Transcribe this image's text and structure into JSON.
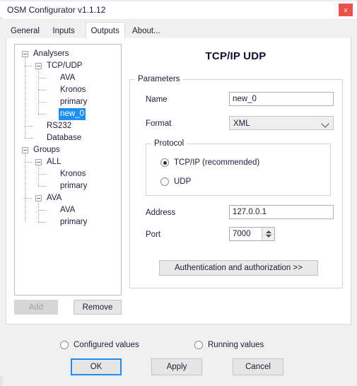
{
  "window": {
    "title": "OSM Configurator v1.1.12",
    "close_label": "x"
  },
  "tabs": [
    {
      "label": "General",
      "active": false
    },
    {
      "label": "Inputs",
      "active": false
    },
    {
      "label": "Outputs",
      "active": true
    },
    {
      "label": "About...",
      "active": false
    }
  ],
  "tree": {
    "nodes": [
      {
        "label": "Analysers",
        "depth": 0,
        "expander": "minus",
        "selected": false
      },
      {
        "label": "TCP/UDP",
        "depth": 1,
        "expander": "minus",
        "selected": false
      },
      {
        "label": "AVA",
        "depth": 2,
        "expander": "none",
        "selected": false
      },
      {
        "label": "Kronos",
        "depth": 2,
        "expander": "none",
        "selected": false
      },
      {
        "label": "primary",
        "depth": 2,
        "expander": "none",
        "selected": false
      },
      {
        "label": "new_0",
        "depth": 2,
        "expander": "none",
        "selected": true
      },
      {
        "label": "RS232",
        "depth": 1,
        "expander": "none",
        "selected": false
      },
      {
        "label": "Database",
        "depth": 1,
        "expander": "none",
        "selected": false
      },
      {
        "label": "Groups",
        "depth": 0,
        "expander": "minus",
        "selected": false
      },
      {
        "label": "ALL",
        "depth": 1,
        "expander": "minus",
        "selected": false
      },
      {
        "label": "Kronos",
        "depth": 2,
        "expander": "none",
        "selected": false
      },
      {
        "label": "primary",
        "depth": 2,
        "expander": "none",
        "selected": false
      },
      {
        "label": "AVA",
        "depth": 1,
        "expander": "minus",
        "selected": false
      },
      {
        "label": "AVA",
        "depth": 2,
        "expander": "none",
        "selected": false
      },
      {
        "label": "primary",
        "depth": 2,
        "expander": "none",
        "selected": false
      }
    ],
    "add_label": "Add",
    "remove_label": "Remove",
    "add_enabled": false,
    "remove_enabled": true
  },
  "detail": {
    "title": "TCP/IP UDP",
    "parameters_legend": "Parameters",
    "name_label": "Name",
    "name_value": "new_0",
    "format_label": "Format",
    "format_value": "XML",
    "protocol_legend": "Protocol",
    "protocol_options": [
      {
        "label": "TCP/IP (recommended)",
        "selected": true
      },
      {
        "label": "UDP",
        "selected": false
      }
    ],
    "address_label": "Address",
    "address_value": "127.0.0.1",
    "port_label": "Port",
    "port_value": "7000",
    "auth_button_label": "Authentication and authorization >>"
  },
  "footer": {
    "value_modes": [
      {
        "label": "Configured values",
        "selected": true
      },
      {
        "label": "Running values",
        "selected": false
      }
    ],
    "ok_label": "OK",
    "apply_label": "Apply",
    "cancel_label": "Cancel"
  },
  "colors": {
    "accent": "#1f8ef1",
    "close_button": "#e8524a",
    "window_background": "#f0f0f0",
    "panel_background": "#ffffff"
  }
}
